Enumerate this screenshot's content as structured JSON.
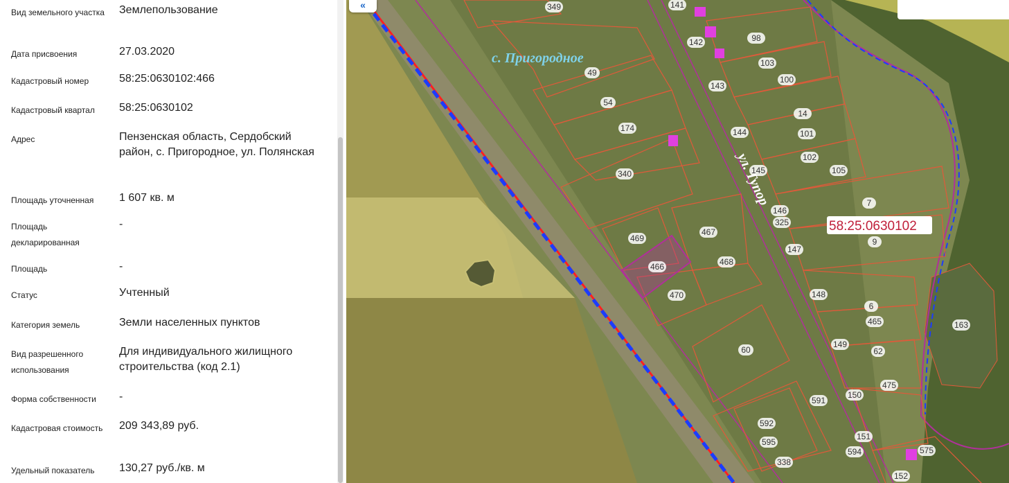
{
  "fields": [
    {
      "label": "Вид земельного участка",
      "value": "Землепользование"
    },
    {
      "label": "Дата присвоения",
      "value": "27.03.2020"
    },
    {
      "label": "Кадастровый номер",
      "value": "58:25:0630102:466"
    },
    {
      "label": "Кадастровый квартал",
      "value": "58:25:0630102"
    },
    {
      "label": "Адрес",
      "value": "Пензенская область, Сердобский район, с. Пригородное, ул. Полянская"
    },
    {
      "label": "Площадь уточненная",
      "value": "1 607 кв. м"
    },
    {
      "label": "Площадь декларированная",
      "value": "-"
    },
    {
      "label": "Площадь",
      "value": "-"
    },
    {
      "label": "Статус",
      "value": "Учтенный"
    },
    {
      "label": "Категория земель",
      "value": "Земли населенных пунктов"
    },
    {
      "label": "Вид разрешенного использования",
      "value": "Для индивидуального жилищного строительства (код 2.1)"
    },
    {
      "label": "Форма собственности",
      "value": "-"
    },
    {
      "label": "Кадастровая стоимость",
      "value": "209 343,89 руб."
    },
    {
      "label": "Удельный показатель кадастровой",
      "value": "130,27 руб./кв. м"
    }
  ],
  "map": {
    "village_label": "с. Пригородное",
    "street_label": "ул. Тупор",
    "quarter_label": "58:25:0630102",
    "collapse_icon": "«",
    "selected_parcel": "466",
    "parcel_labels": [
      "349",
      "141",
      "142",
      "98",
      "103",
      "100",
      "143",
      "14",
      "144",
      "101",
      "145",
      "102",
      "105",
      "146",
      "7",
      "325",
      "9",
      "147",
      "148",
      "6",
      "465",
      "149",
      "62",
      "475",
      "150",
      "163",
      "151",
      "575",
      "152",
      "49",
      "54",
      "174",
      "340",
      "469",
      "467",
      "466",
      "468",
      "470",
      "60",
      "591",
      "592",
      "595",
      "594",
      "338"
    ],
    "colors": {
      "parcel_border": "#e05a3a",
      "selected": "#b0309a",
      "road_red": "#ff2020",
      "boundary_blue": "#1b3cff",
      "field_yellow": "#d8c46a",
      "label_blue": "#7fd2ea",
      "quarter_text": "#c0203a"
    }
  }
}
